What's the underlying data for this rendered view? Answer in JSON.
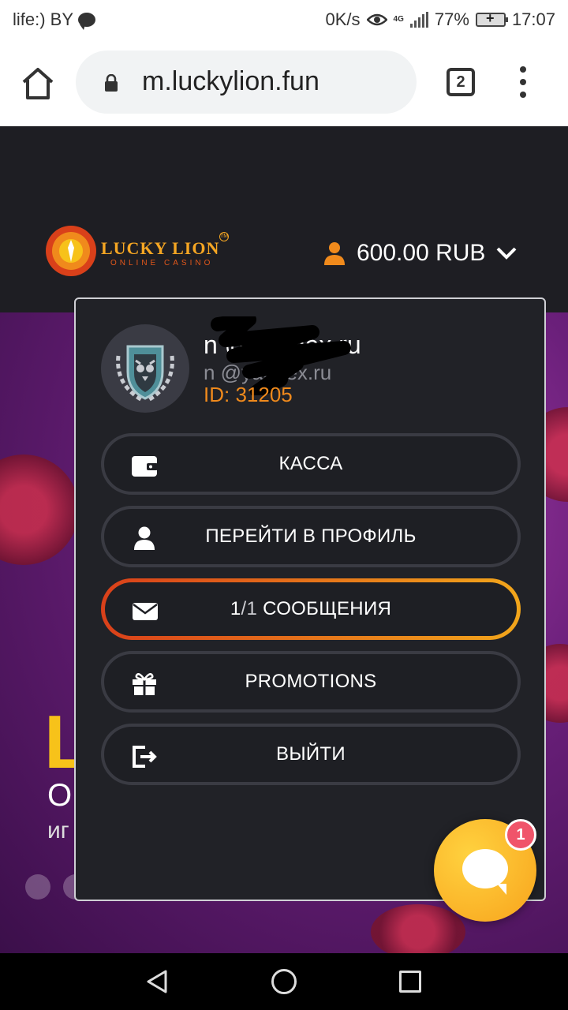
{
  "status_bar": {
    "carrier": "life:) BY",
    "net_speed": "0K/s",
    "net_type": "4G",
    "battery": "77%",
    "time": "17:07"
  },
  "browser": {
    "url": "m.luckylion.fun",
    "tab_count": "2"
  },
  "site": {
    "logo_text": "LUCKY LION",
    "logo_sub": "ONLINE CASINO",
    "logo_tm": "TM",
    "balance": "600.00 RUB"
  },
  "hero": {
    "big_letter": "L",
    "line1": "О",
    "line2": "иг"
  },
  "profile": {
    "username": "n      @yandex.ru",
    "email": "n     @yandex.ru",
    "user_id": "ID: 31205"
  },
  "menu": {
    "cashier": "КАССА",
    "profile": "ПЕРЕЙТИ В ПРОФИЛЬ",
    "messages_count_read": "1",
    "messages_sep": "/",
    "messages_count_total": "1",
    "messages_label": "СООБЩЕНИЯ",
    "promotions": "PROMOTIONS",
    "logout": "ВЫЙТИ"
  },
  "chat": {
    "badge": "1"
  },
  "colors": {
    "accent_orange": "#f08a1c",
    "badge_red": "#f0546a",
    "chat_yellow": "#f8a31c",
    "panel_bg": "#212227"
  },
  "icons": [
    "chat-bubble-icon",
    "eye-icon",
    "signal-icon",
    "battery-icon",
    "home-icon",
    "lock-icon",
    "tabs-icon",
    "overflow-menu-icon",
    "user-icon",
    "chevron-down-icon",
    "wallet-icon",
    "envelope-icon",
    "gift-icon",
    "logout-icon",
    "chat-icon",
    "nav-back-icon",
    "nav-home-icon",
    "nav-recent-icon"
  ]
}
